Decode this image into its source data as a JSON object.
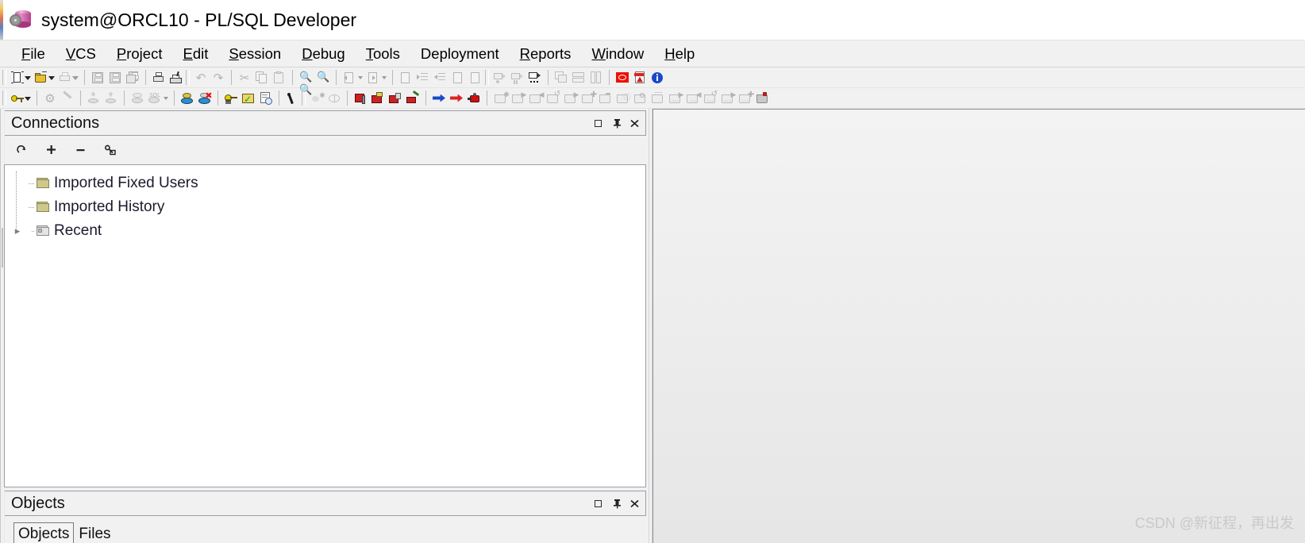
{
  "window": {
    "title": "system@ORCL10 - PL/SQL Developer",
    "app_icon": "oracle-database-icon"
  },
  "menubar": {
    "items": [
      {
        "label": "File",
        "accel": "F"
      },
      {
        "label": "VCS",
        "accel": "V"
      },
      {
        "label": "Project",
        "accel": "P"
      },
      {
        "label": "Edit",
        "accel": "E"
      },
      {
        "label": "Session",
        "accel": "S"
      },
      {
        "label": "Debug",
        "accel": "D"
      },
      {
        "label": "Tools",
        "accel": "T"
      },
      {
        "label": "Deployment",
        "accel": ""
      },
      {
        "label": "Reports",
        "accel": "R"
      },
      {
        "label": "Window",
        "accel": "W"
      },
      {
        "label": "Help",
        "accel": "H"
      }
    ]
  },
  "toolbar_top": {
    "groups": [
      {
        "buttons": [
          {
            "name": "new-file-icon",
            "dropdown": true,
            "enabled": true
          },
          {
            "name": "open-file-icon",
            "dropdown": true,
            "enabled": true
          },
          {
            "name": "print-preview-icon",
            "dropdown": true,
            "enabled": false
          }
        ]
      },
      {
        "buttons": [
          {
            "name": "save-icon",
            "dropdown": false,
            "enabled": false
          },
          {
            "name": "save-as-icon",
            "dropdown": false,
            "enabled": false
          },
          {
            "name": "save-all-icon",
            "dropdown": false,
            "enabled": false
          }
        ]
      },
      {
        "buttons": [
          {
            "name": "print-icon",
            "dropdown": false,
            "enabled": true
          },
          {
            "name": "print-setup-icon",
            "dropdown": false,
            "enabled": true
          }
        ]
      },
      {
        "buttons": [
          {
            "name": "undo-icon",
            "dropdown": false,
            "enabled": false
          },
          {
            "name": "redo-icon",
            "dropdown": false,
            "enabled": false
          }
        ]
      },
      {
        "buttons": [
          {
            "name": "cut-icon",
            "dropdown": false,
            "enabled": false
          },
          {
            "name": "copy-icon",
            "dropdown": false,
            "enabled": false
          },
          {
            "name": "paste-icon",
            "dropdown": false,
            "enabled": false
          }
        ]
      },
      {
        "buttons": [
          {
            "name": "find-icon",
            "dropdown": false,
            "enabled": false
          },
          {
            "name": "find-next-icon",
            "dropdown": false,
            "enabled": false
          }
        ]
      },
      {
        "buttons": [
          {
            "name": "navigate-back-icon",
            "dropdown": true,
            "enabled": false
          },
          {
            "name": "navigate-forward-icon",
            "dropdown": true,
            "enabled": false
          }
        ]
      },
      {
        "buttons": [
          {
            "name": "check-syntax-icon",
            "dropdown": false,
            "enabled": false
          },
          {
            "name": "indent-icon",
            "dropdown": false,
            "enabled": false
          },
          {
            "name": "outdent-icon",
            "dropdown": false,
            "enabled": false
          },
          {
            "name": "comment-icon",
            "dropdown": false,
            "enabled": false
          },
          {
            "name": "uncomment-icon",
            "dropdown": false,
            "enabled": false
          }
        ]
      },
      {
        "buttons": [
          {
            "name": "record-macro-icon",
            "dropdown": false,
            "enabled": false
          },
          {
            "name": "pause-macro-icon",
            "dropdown": false,
            "enabled": false
          },
          {
            "name": "play-macro-icon",
            "dropdown": false,
            "enabled": true
          }
        ]
      },
      {
        "buttons": [
          {
            "name": "cascade-windows-icon",
            "dropdown": false,
            "enabled": false
          },
          {
            "name": "tile-horizontal-icon",
            "dropdown": false,
            "enabled": false
          },
          {
            "name": "tile-vertical-icon",
            "dropdown": false,
            "enabled": false
          }
        ]
      },
      {
        "buttons": [
          {
            "name": "oracle-logo-icon",
            "dropdown": false,
            "enabled": true
          },
          {
            "name": "export-pdf-icon",
            "dropdown": false,
            "enabled": true
          },
          {
            "name": "about-info-icon",
            "dropdown": false,
            "enabled": true
          }
        ]
      }
    ]
  },
  "toolbar_second": {
    "groups": [
      {
        "buttons": [
          {
            "name": "sql-window-key-icon",
            "dropdown": true,
            "enabled": true
          }
        ]
      },
      {
        "buttons": [
          {
            "name": "settings-gear-icon",
            "dropdown": false,
            "enabled": false
          },
          {
            "name": "beautifier-icon",
            "dropdown": false,
            "enabled": false
          }
        ]
      },
      {
        "buttons": [
          {
            "name": "import-data-icon",
            "dropdown": false,
            "enabled": false
          },
          {
            "name": "export-data-icon",
            "dropdown": false,
            "enabled": false
          }
        ]
      },
      {
        "buttons": [
          {
            "name": "commit-icon",
            "dropdown": false,
            "enabled": false
          },
          {
            "name": "execute-sql-icon",
            "dropdown": true,
            "enabled": false
          }
        ]
      },
      {
        "buttons": [
          {
            "name": "test-window-icon",
            "dropdown": false,
            "enabled": true
          },
          {
            "name": "rollback-icon",
            "dropdown": false,
            "enabled": true
          }
        ]
      },
      {
        "buttons": [
          {
            "name": "session-key-icon",
            "dropdown": false,
            "enabled": true
          },
          {
            "name": "task-list-icon",
            "dropdown": false,
            "enabled": true
          },
          {
            "name": "history-report-icon",
            "dropdown": false,
            "enabled": true
          }
        ]
      },
      {
        "buttons": [
          {
            "name": "tools-wrench-icon",
            "dropdown": false,
            "enabled": true
          }
        ]
      },
      {
        "buttons": [
          {
            "name": "new-object-icon",
            "dropdown": false,
            "enabled": false
          },
          {
            "name": "browse-object-icon",
            "dropdown": false,
            "enabled": false
          }
        ]
      },
      {
        "buttons": [
          {
            "name": "package-icon",
            "dropdown": false,
            "enabled": true
          },
          {
            "name": "package-body-icon",
            "dropdown": false,
            "enabled": true
          },
          {
            "name": "procedure-icon",
            "dropdown": false,
            "enabled": true
          },
          {
            "name": "trigger-icon",
            "dropdown": false,
            "enabled": true
          }
        ]
      },
      {
        "buttons": [
          {
            "name": "step-into-icon",
            "dropdown": false,
            "enabled": true
          },
          {
            "name": "step-over-icon",
            "dropdown": false,
            "enabled": true
          },
          {
            "name": "stop-debug-icon",
            "dropdown": false,
            "enabled": true
          }
        ]
      },
      {
        "buttons": [
          {
            "name": "browser-folder-refresh-icon",
            "dropdown": false,
            "enabled": false
          },
          {
            "name": "browser-folder-next-icon",
            "dropdown": false,
            "enabled": false
          },
          {
            "name": "browser-folder-prev-icon",
            "dropdown": false,
            "enabled": false
          },
          {
            "name": "browser-folder-open-icon",
            "dropdown": false,
            "enabled": false
          },
          {
            "name": "browser-folder-forward-icon",
            "dropdown": false,
            "enabled": false
          },
          {
            "name": "browser-folder-add-icon",
            "dropdown": false,
            "enabled": false
          },
          {
            "name": "browser-folder-minimize-icon",
            "dropdown": false,
            "enabled": false
          },
          {
            "name": "browser-folder-info-icon",
            "dropdown": false,
            "enabled": false
          },
          {
            "name": "browser-folder-search-icon",
            "dropdown": false,
            "enabled": false
          },
          {
            "name": "browser-folder-grid-icon",
            "dropdown": false,
            "enabled": false
          },
          {
            "name": "browser-folder-more-next-icon",
            "dropdown": false,
            "enabled": false
          },
          {
            "name": "browser-folder-more-prev-icon",
            "dropdown": false,
            "enabled": false
          },
          {
            "name": "browser-folder-more-open-icon",
            "dropdown": false,
            "enabled": false
          },
          {
            "name": "browser-folder-more-forward-icon",
            "dropdown": false,
            "enabled": false
          },
          {
            "name": "browser-folder-more-add-icon",
            "dropdown": false,
            "enabled": false
          },
          {
            "name": "browser-folder-lock-icon",
            "dropdown": false,
            "enabled": false
          }
        ]
      }
    ]
  },
  "connections_panel": {
    "title": "Connections",
    "controls": [
      {
        "name": "maximize-panel-button",
        "glyph": "square"
      },
      {
        "name": "auto-hide-pin-button",
        "glyph": "pin"
      },
      {
        "name": "close-panel-button",
        "glyph": "close"
      }
    ],
    "toolbar": [
      {
        "name": "refresh-connections-button",
        "glyph": "refresh"
      },
      {
        "name": "add-connection-button",
        "glyph": "plus"
      },
      {
        "name": "remove-connection-button",
        "glyph": "minus"
      },
      {
        "name": "edit-connection-button",
        "glyph": "key"
      }
    ],
    "tree": [
      {
        "label": "Imported Fixed Users",
        "expandable": false,
        "folder": "olive"
      },
      {
        "label": "Imported History",
        "expandable": false,
        "folder": "olive"
      },
      {
        "label": "Recent",
        "expandable": true,
        "folder": "gray"
      }
    ]
  },
  "objects_panel": {
    "title": "Objects",
    "controls": [
      {
        "name": "maximize-panel-button",
        "glyph": "square"
      },
      {
        "name": "auto-hide-pin-button",
        "glyph": "pin"
      },
      {
        "name": "close-panel-button",
        "glyph": "close"
      }
    ],
    "tabs": [
      {
        "label": "Objects",
        "active": true
      },
      {
        "label": "Files",
        "active": false
      }
    ]
  },
  "watermark": {
    "text": "CSDN @新征程，再出发"
  },
  "colors": {
    "accent_red": "#ee1100",
    "accent_blue": "#1a49c8",
    "folder_olive": "#cdc98e",
    "title_db": "#c0539a",
    "panel_bg": "#f1f1f1",
    "tree_bg": "#ffffff"
  }
}
